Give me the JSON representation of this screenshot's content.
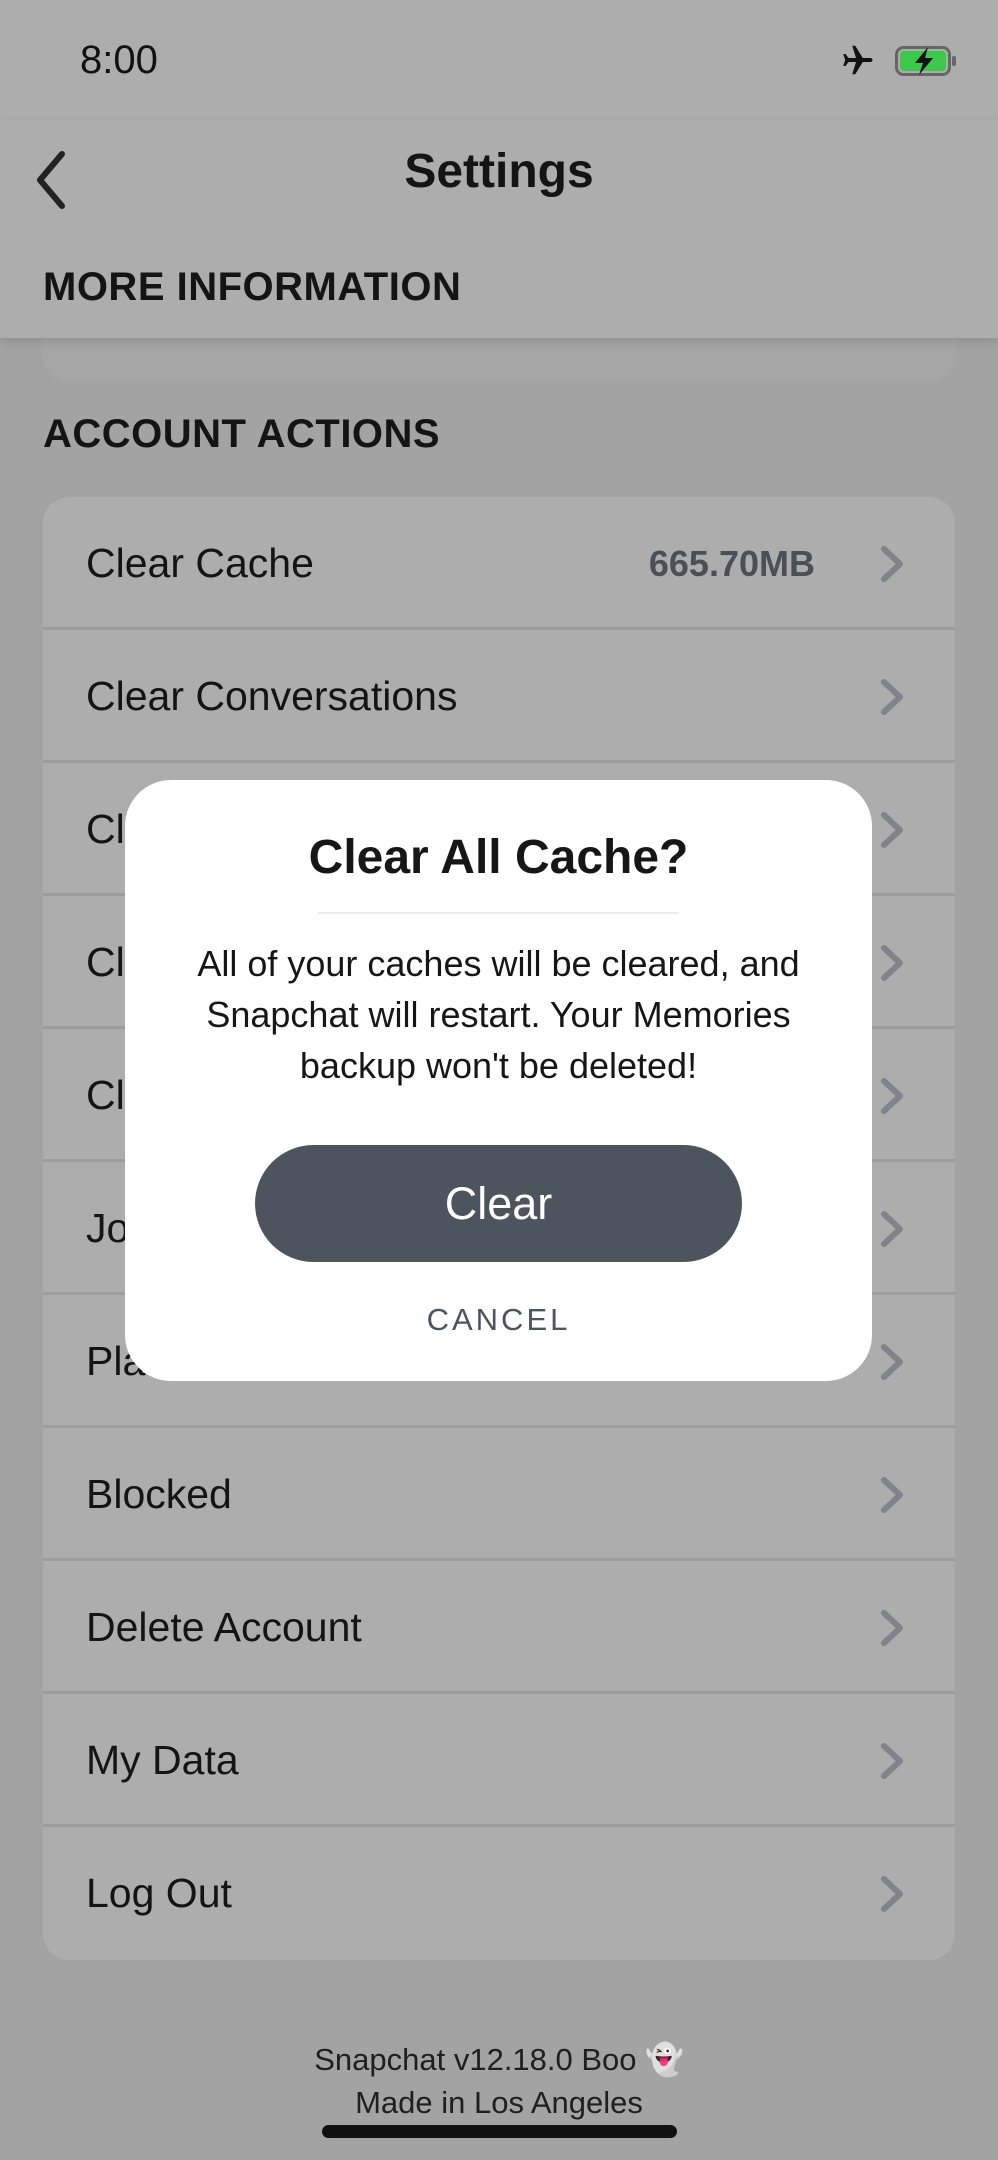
{
  "status_bar": {
    "time": "8:00",
    "icons": [
      "airplane-icon",
      "battery-charging-icon"
    ],
    "battery_color": "#3cc84a"
  },
  "header": {
    "title": "Settings",
    "back_icon": "chevron-left-icon"
  },
  "sections": {
    "more_information": {
      "title": "MORE INFORMATION"
    },
    "account_actions": {
      "title": "ACCOUNT ACTIONS",
      "items": [
        {
          "label": "Clear Cache",
          "value": "665.70MB"
        },
        {
          "label": "Clear Conversations",
          "value": ""
        },
        {
          "label": "Cl",
          "value": ""
        },
        {
          "label": "Cl",
          "value": ""
        },
        {
          "label": "Cl",
          "value": ""
        },
        {
          "label": "Jo",
          "value": ""
        },
        {
          "label": "Pla",
          "value": ""
        },
        {
          "label": "Blocked",
          "value": ""
        },
        {
          "label": "Delete Account",
          "value": ""
        },
        {
          "label": "My Data",
          "value": ""
        },
        {
          "label": "Log Out",
          "value": ""
        }
      ]
    }
  },
  "footer": {
    "version": "Snapchat v12.18.0 Boo 👻",
    "made_in": "Made in Los Angeles"
  },
  "dialog": {
    "title": "Clear All Cache?",
    "body": "All of your caches will be cleared, and Snapchat will restart. Your Memories backup won't be deleted!",
    "confirm_label": "Clear",
    "cancel_label": "CANCEL",
    "confirm_color": "#4e545e"
  }
}
